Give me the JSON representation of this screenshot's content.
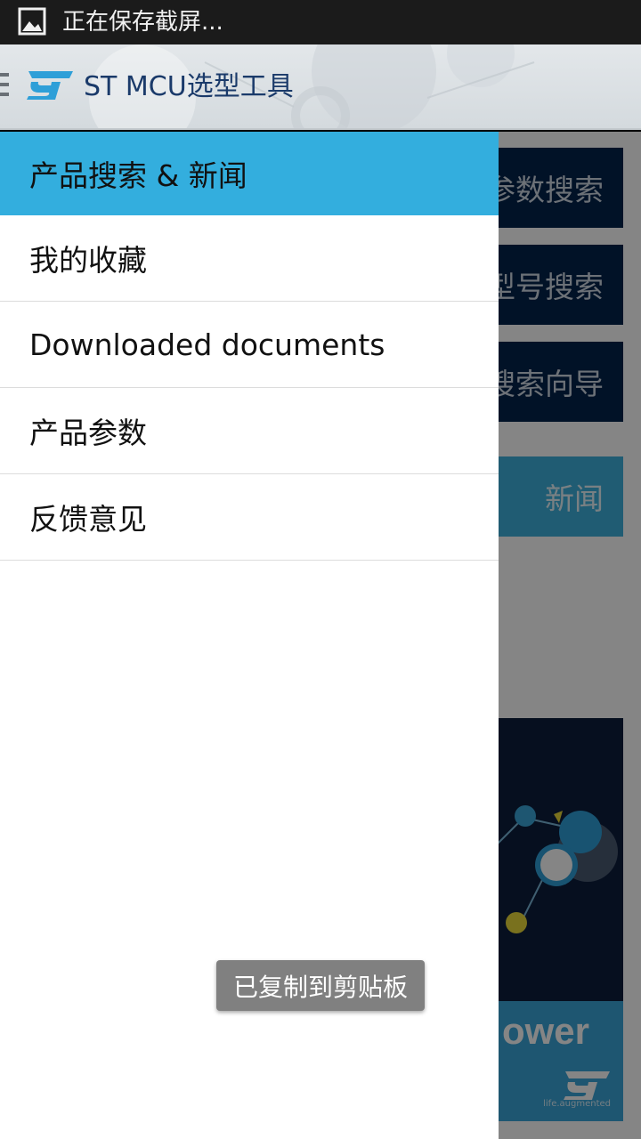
{
  "status_bar": {
    "notification_icon": "image-icon",
    "text": "正在保存截屏..."
  },
  "action_bar": {
    "title": "ST MCU选型工具",
    "logo": "st-logo"
  },
  "drawer": {
    "items": [
      {
        "label": "产品搜索 & 新闻",
        "active": true
      },
      {
        "label": "我的收藏",
        "active": false
      },
      {
        "label": "Downloaded documents",
        "active": false
      },
      {
        "label": "产品参数",
        "active": false
      },
      {
        "label": "反馈意见",
        "active": false
      }
    ]
  },
  "main": {
    "buttons": [
      {
        "label": "参数搜索"
      },
      {
        "label": "型号搜索"
      },
      {
        "label": "搜索向导"
      },
      {
        "label": "新闻"
      }
    ],
    "banner": {
      "text": "ower",
      "tagline": "life.augmented"
    }
  },
  "toast": {
    "text": "已复制到剪贴板"
  },
  "colors": {
    "accent": "#33aede",
    "brand_dark": "#03234b",
    "title": "#1a3a6a"
  }
}
